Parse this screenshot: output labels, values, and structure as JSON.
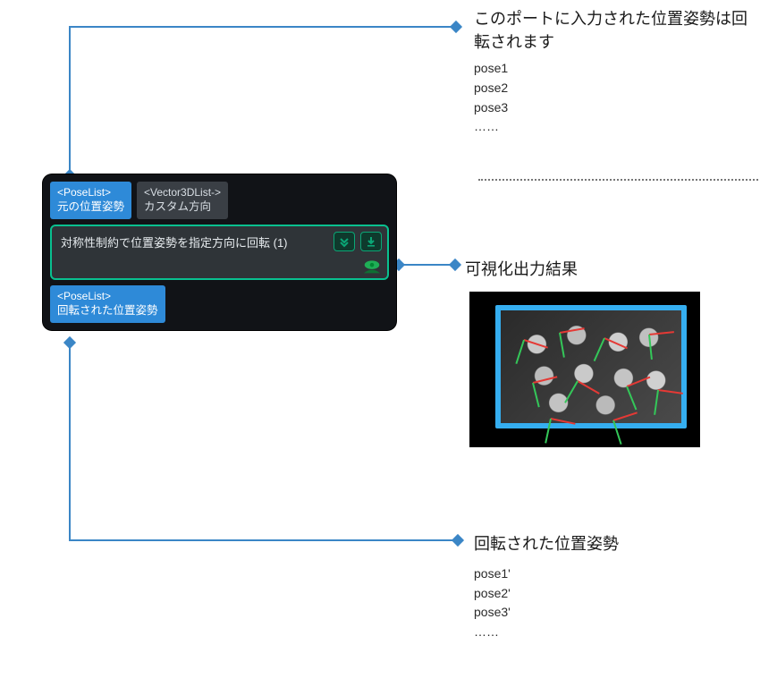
{
  "annotations": {
    "input": {
      "text": "このポートに入力された位置姿勢は回転されます",
      "list": [
        "pose1",
        "pose2",
        "pose3",
        "……"
      ]
    },
    "visualize": {
      "text": "可視化出力結果"
    },
    "output": {
      "text": "回転された位置姿勢",
      "list": [
        "pose1'",
        "pose2'",
        "pose3'",
        "……"
      ]
    }
  },
  "node": {
    "input_ports": [
      {
        "type": "<PoseList>",
        "label": "元の位置姿勢",
        "style": "blue"
      },
      {
        "type": "<Vector3DList->",
        "label": "カスタム方向",
        "style": "gray"
      }
    ],
    "title": "対称性制約で位置姿勢を指定方向に回転 (1)",
    "output_ports": [
      {
        "type": "<PoseList>",
        "label": "回転された位置姿勢",
        "style": "blue"
      }
    ]
  }
}
